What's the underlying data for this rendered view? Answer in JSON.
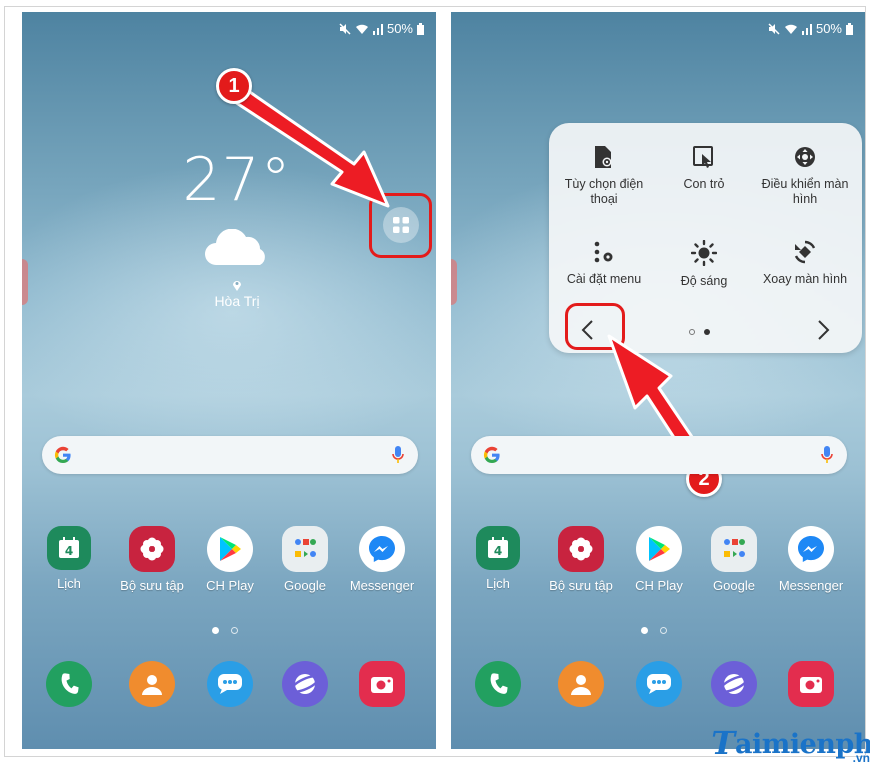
{
  "status": {
    "battery": "50%"
  },
  "weather": {
    "temperature": "27°",
    "location": "Hòa Trị"
  },
  "search": {
    "logo": "G"
  },
  "apps": [
    {
      "label": "Lịch",
      "icon": "calendar-icon",
      "color": "#1e8a5c",
      "glyph": "4"
    },
    {
      "label": "Bộ sưu tập",
      "icon": "gallery-icon",
      "color": "#c8233f"
    },
    {
      "label": "CH Play",
      "icon": "play-store-icon",
      "color": "#ffffff"
    },
    {
      "label": "Google",
      "icon": "google-folder-icon",
      "color": "#e9eef0"
    },
    {
      "label": "Messenger",
      "icon": "messenger-icon",
      "color": "#ffffff"
    }
  ],
  "dock": [
    {
      "icon": "phone-icon",
      "color": "#22a060"
    },
    {
      "icon": "contacts-icon",
      "color": "#f08c2e"
    },
    {
      "icon": "messages-icon",
      "color": "#2a9ee6"
    },
    {
      "icon": "internet-icon",
      "color": "#6c5fd8"
    },
    {
      "icon": "camera-icon",
      "color": "#e32d4e"
    }
  ],
  "quick_panel": {
    "items": [
      {
        "label": "Tùy chọn điện thoại",
        "icon": "phone-settings-icon"
      },
      {
        "label": "Con trỏ",
        "icon": "cursor-icon"
      },
      {
        "label": "Điều khiển màn hình",
        "icon": "screen-control-icon"
      },
      {
        "label": "Cài đặt menu",
        "icon": "menu-settings-icon"
      },
      {
        "label": "Độ sáng",
        "icon": "brightness-icon"
      },
      {
        "label": "Xoay màn hình",
        "icon": "rotate-screen-icon"
      }
    ]
  },
  "annotations": {
    "step1": "1",
    "step2": "2",
    "accent": "#e31b1b"
  },
  "brand": {
    "initial": "T",
    "name": "aimienphi",
    "tld": ".vn"
  }
}
